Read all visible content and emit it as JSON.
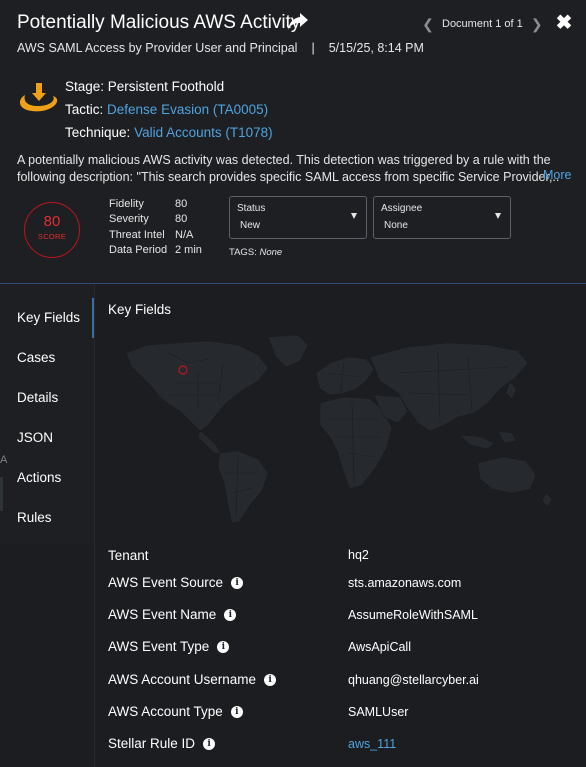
{
  "header": {
    "title": "Potentially Malicious AWS Activity",
    "document_label": "Document 1 of 1",
    "subtitle_rule": "AWS SAML Access by Provider User and Principal",
    "subtitle_separator": "|",
    "subtitle_time": "5/15/25, 8:14 PM",
    "icons": [
      "share-arrow-icon",
      "chevron-left-icon",
      "chevron-right-icon",
      "close-icon"
    ]
  },
  "mitre": {
    "icon": "mitre-kill-chain-icon",
    "stage_label": "Stage:",
    "stage_value": "Persistent Foothold",
    "tactic_label": "Tactic:",
    "tactic_value": "Defense Evasion (TA0005)",
    "technique_label": "Technique:",
    "technique_value": "Valid Accounts (T1078)"
  },
  "description": {
    "text": "A potentially malicious AWS activity was detected. This detection was triggered by a rule with the following description: \"This search provides specific SAML access from specific Service Provider,..",
    "more_label": "More"
  },
  "score": {
    "value": "80",
    "label": "SCORE",
    "color": "#e0302e"
  },
  "metrics": [
    {
      "label": "Fidelity",
      "value": "80"
    },
    {
      "label": "Severity",
      "value": "80"
    },
    {
      "label": "Threat Intel",
      "value": "N/A"
    },
    {
      "label": "Data Period",
      "value": "2 min"
    }
  ],
  "status_dropdown": {
    "label": "Status",
    "value": "New"
  },
  "assignee_dropdown": {
    "label": "Assignee",
    "value": "None"
  },
  "tags": {
    "label": "TAGS:",
    "value": "None"
  },
  "sidebar": {
    "items": [
      {
        "label": "Key Fields",
        "active": true
      },
      {
        "label": "Cases"
      },
      {
        "label": "Details"
      },
      {
        "label": "JSON"
      },
      {
        "label": "Actions"
      },
      {
        "label": "Rules"
      }
    ],
    "accent": "#3a6ea5"
  },
  "key_fields": {
    "title": "Key Fields",
    "map_marker_color": "#c0141c",
    "rows": [
      {
        "label": "Tenant",
        "value": "hq2",
        "info": false
      },
      {
        "label": "AWS Event Source",
        "value": "sts.amazonaws.com",
        "info": true
      },
      {
        "label": "AWS Event Name",
        "value": "AssumeRoleWithSAML",
        "info": true
      },
      {
        "label": "AWS Event Type",
        "value": "AwsApiCall",
        "info": true
      },
      {
        "label": "AWS Account Username",
        "value": "qhuang@stellarcyber.ai",
        "info": true
      },
      {
        "label": "AWS Account Type",
        "value": "SAMLUser",
        "info": true
      },
      {
        "label": "Stellar Rule ID",
        "value": "aws_111",
        "info": true,
        "link": true
      }
    ]
  },
  "colors": {
    "background": "#1b1d21",
    "link": "#4fa3de",
    "divider": "#2d4f73",
    "score_ring": "#c0141c"
  }
}
